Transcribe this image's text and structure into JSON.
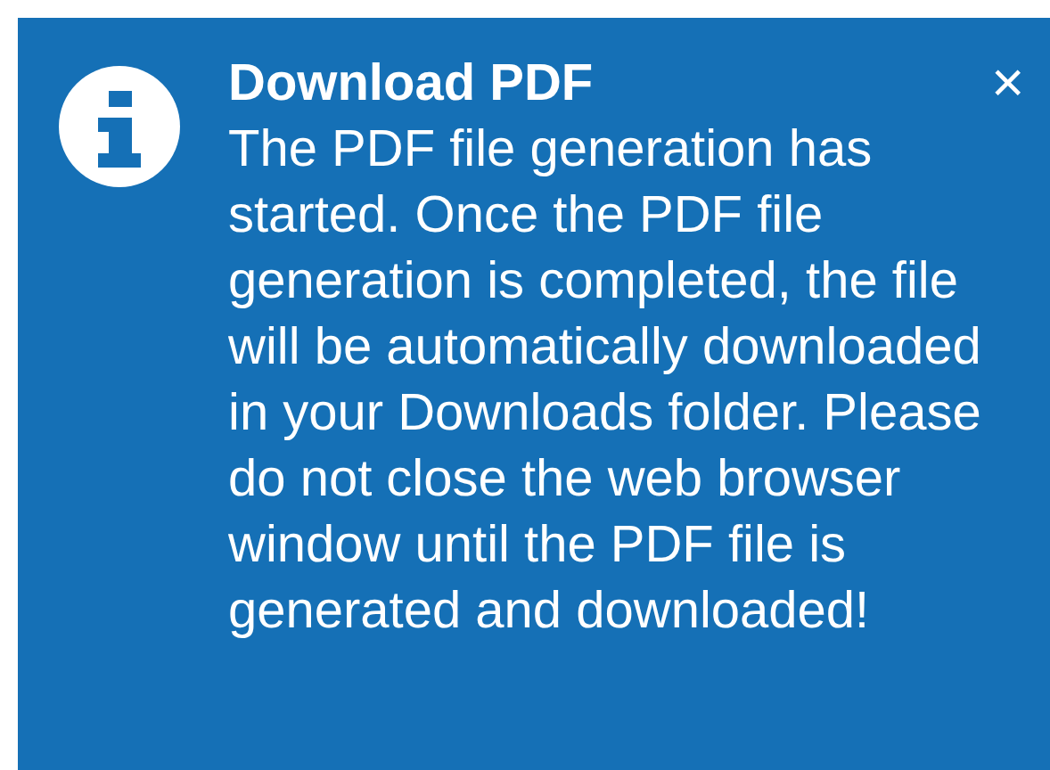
{
  "toast": {
    "title": "Download PDF",
    "message": "The PDF file generation has started. Once the PDF file generation is completed, the file will be automatically downloaded in your Downloads folder. Please do not close the web browser window until the PDF file is generated and downloaded!",
    "close": "×"
  }
}
